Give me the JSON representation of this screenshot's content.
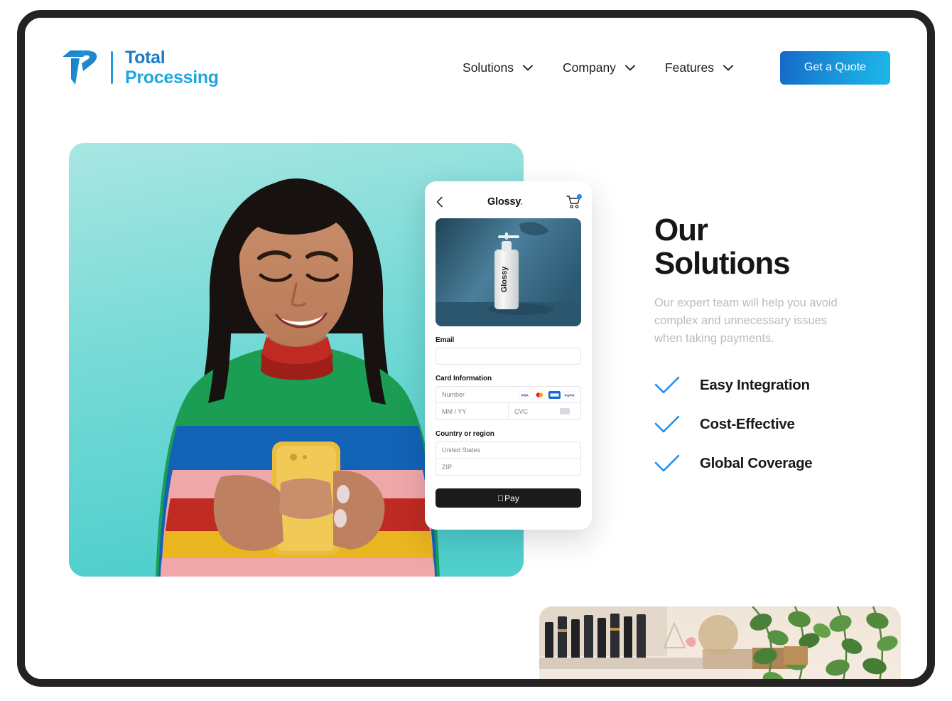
{
  "brand": {
    "logo_icon": "total-processing-logo",
    "line1": "Total",
    "line2": "Processing"
  },
  "nav": {
    "items": [
      {
        "label": "Solutions",
        "icon": "chevron-down-icon"
      },
      {
        "label": "Company",
        "icon": "chevron-down-icon"
      },
      {
        "label": "Features",
        "icon": "chevron-down-icon"
      }
    ],
    "cta_label": "Get a Quote",
    "cta_gradient_from": "#1569c7",
    "cta_gradient_to": "#1cb8ea"
  },
  "hero": {
    "image_alt": "smiling woman in colorful striped sweater using a yellow phone",
    "background_color": "#7fdcd8"
  },
  "checkout": {
    "back_icon": "back-chevron-icon",
    "title": "Glossy",
    "title_dot": ".",
    "cart_icon": "shopping-cart-icon",
    "cart_badge_color": "#1f8ef1",
    "product_image_alt": "white Glossy pump bottle on blue background",
    "product_label": "Glossy",
    "email_label": "Email",
    "email_value": "",
    "card_label": "Card Information",
    "card_number_placeholder": "Number",
    "expiry_placeholder": "MM / YY",
    "cvc_placeholder": "CVC",
    "card_brands": [
      {
        "name": "visa-icon",
        "color": "#ffffff"
      },
      {
        "name": "mastercard-icon",
        "color": "#ffffff"
      },
      {
        "name": "amex-icon",
        "color": "#1668d6"
      },
      {
        "name": "paypal-icon",
        "color": "#ffffff"
      }
    ],
    "country_label": "Country or region",
    "country_value": "United States",
    "zip_placeholder": "ZIP",
    "pay_button_label": "Pay",
    "pay_button_icon": "apple-logo-icon"
  },
  "solutions": {
    "title": "Our\nSolutions",
    "copy": "Our expert team will help you avoid complex and unnecessary issues when taking payments.",
    "benefits": [
      {
        "icon": "check-icon",
        "label": "Easy Integration"
      },
      {
        "icon": "check-icon",
        "label": "Cost-Effective"
      },
      {
        "icon": "check-icon",
        "label": "Global Coverage"
      }
    ],
    "check_color": "#1f8ef1"
  },
  "store_photo": {
    "image_alt": "shop counter with black cosmetic bottles and hanging green plants"
  }
}
